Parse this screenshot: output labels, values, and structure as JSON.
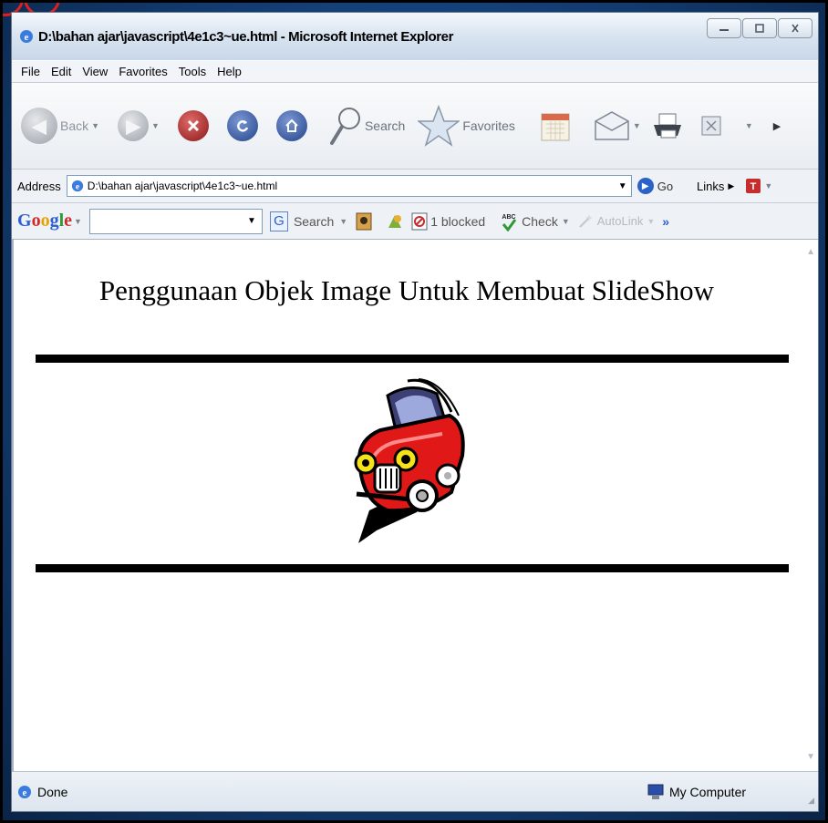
{
  "window": {
    "title": "D:\\bahan ajar\\javascript\\4e1c3~ue.html - Microsoft Internet Explorer",
    "minimize_label": "_",
    "maximize_label": "□",
    "close_label": "X"
  },
  "menubar": {
    "items": [
      {
        "label": "File"
      },
      {
        "label": "Edit"
      },
      {
        "label": "View"
      },
      {
        "label": "Favorites"
      },
      {
        "label": "Tools"
      },
      {
        "label": "Help"
      }
    ]
  },
  "toolbar": {
    "back_label": "Back",
    "search_label": "Search",
    "favorites_label": "Favorites"
  },
  "addressbar": {
    "label": "Address",
    "value": "D:\\bahan ajar\\javascript\\4e1c3~ue.html",
    "go_label": "Go",
    "links_label": "Links"
  },
  "googlebar": {
    "logo_g": "G",
    "logo_o1": "o",
    "logo_o2": "o",
    "logo_g2": "g",
    "logo_l": "l",
    "logo_e": "e",
    "search_label": "Search",
    "blocked_label": "1 blocked",
    "check_label": "Check",
    "autolink_label": "AutoLink",
    "more_label": "»"
  },
  "content": {
    "heading": "Penggunaan Objek Image Untuk Membuat SlideShow"
  },
  "statusbar": {
    "status_text": "Done",
    "zone_label": "My Computer"
  },
  "colors": {
    "slide_background": "#123c72",
    "title_bar": "#d6e2ef",
    "car_red": "#e01818"
  }
}
